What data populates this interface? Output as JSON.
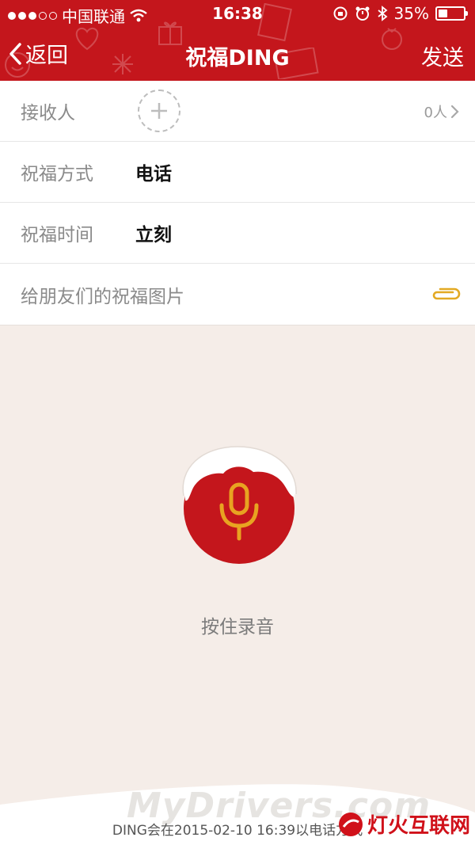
{
  "status_bar": {
    "carrier": "中国联通",
    "time": "16:38",
    "battery": "35%",
    "battery_level": 0.35
  },
  "nav": {
    "back_label": "返回",
    "title": "祝福DING",
    "send_label": "发送"
  },
  "form": {
    "recipient_label": "接收人",
    "recipient_count": "0人",
    "method_label": "祝福方式",
    "method_value": "电话",
    "time_label": "祝福时间",
    "time_value": "立刻",
    "image_label": "给朋友们的祝福图片"
  },
  "record": {
    "hint": "按住录音"
  },
  "footer": {
    "note": "DING会在2015-02-10 16:39以电话方式",
    "watermark": "MyDrivers.com",
    "site_logo": "灯火互联网"
  },
  "colors": {
    "brand_red": "#c4161c",
    "mic_gold": "#e8a321",
    "page_bg": "#f5ede8"
  },
  "icons": [
    "back-chevron-icon",
    "wifi-icon",
    "lock-rotation-icon",
    "alarm-icon",
    "bluetooth-icon",
    "battery-icon",
    "plus-icon",
    "chevron-right-icon",
    "paperclip-icon",
    "microphone-icon"
  ]
}
